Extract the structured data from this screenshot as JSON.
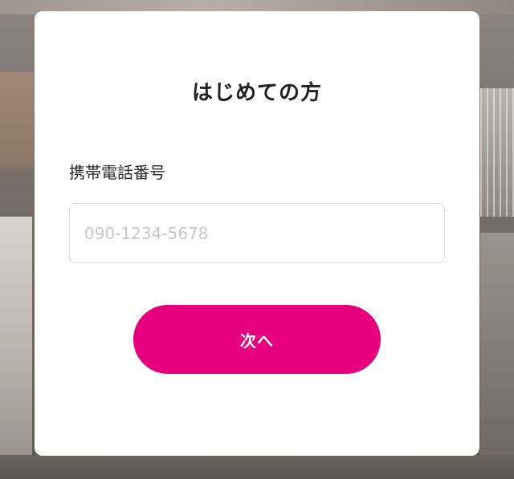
{
  "modal": {
    "title": "はじめての方",
    "phone_label": "携帯電話番号",
    "phone_placeholder": "090-1234-5678",
    "phone_value": "",
    "next_label": "次へ"
  },
  "colors": {
    "accent": "#e6007e",
    "modal_background": "#ffffff",
    "title_text": "#222222",
    "input_border": "#dcdcdc",
    "placeholder": "#c8c8c8"
  }
}
